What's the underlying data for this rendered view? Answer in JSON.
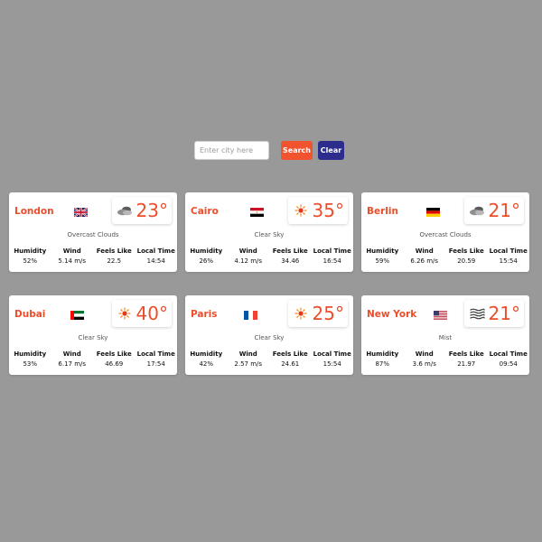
{
  "search": {
    "placeholder": "Enter city here",
    "value": "",
    "search_label": "Search",
    "clear_label": "Clear"
  },
  "colors": {
    "background": "#999999",
    "accent": "#ec4d2a",
    "search_button": "#f0532e",
    "clear_button": "#2b2c8c"
  },
  "labels": {
    "humidity": "Humidity",
    "wind": "Wind",
    "feels_like": "Feels Like",
    "local_time": "Local Time"
  },
  "cards": [
    {
      "city": "London",
      "flag": "uk-flag-icon",
      "weather_icon": "overcast-clouds-icon",
      "temp": "23°",
      "condition": "Overcast Clouds",
      "humidity": "52%",
      "wind": "5.14 m/s",
      "feels_like": "22.5",
      "local_time": "14:54"
    },
    {
      "city": "Cairo",
      "flag": "egypt-flag-icon",
      "weather_icon": "sun-icon",
      "temp": "35°",
      "condition": "Clear Sky",
      "humidity": "26%",
      "wind": "4.12 m/s",
      "feels_like": "34.46",
      "local_time": "16:54"
    },
    {
      "city": "Berlin",
      "flag": "germany-flag-icon",
      "weather_icon": "overcast-clouds-icon",
      "temp": "21°",
      "condition": "Overcast Clouds",
      "humidity": "59%",
      "wind": "6.26 m/s",
      "feels_like": "20.59",
      "local_time": "15:54"
    },
    {
      "city": "Dubai",
      "flag": "uae-flag-icon",
      "weather_icon": "sun-icon",
      "temp": "40°",
      "condition": "Clear Sky",
      "humidity": "53%",
      "wind": "6.17 m/s",
      "feels_like": "46.69",
      "local_time": "17:54"
    },
    {
      "city": "Paris",
      "flag": "france-flag-icon",
      "weather_icon": "sun-icon",
      "temp": "25°",
      "condition": "Clear Sky",
      "humidity": "42%",
      "wind": "2.57 m/s",
      "feels_like": "24.61",
      "local_time": "15:54"
    },
    {
      "city": "New York",
      "flag": "usa-flag-icon",
      "weather_icon": "mist-icon",
      "temp": "21°",
      "condition": "Mist",
      "humidity": "87%",
      "wind": "3.6 m/s",
      "feels_like": "21.97",
      "local_time": "09:54"
    }
  ]
}
